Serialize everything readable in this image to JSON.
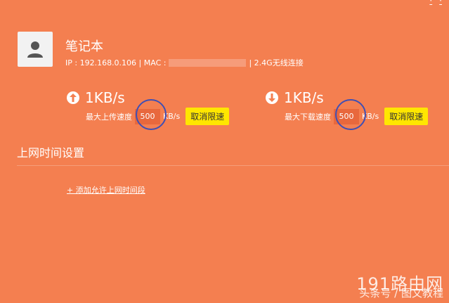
{
  "top_links": [
    "·",
    "·"
  ],
  "device": {
    "name": "笔记本",
    "ip_text": "IP : 192.168.0.106 | MAC :",
    "connection_text": "| 2.4G无线连接"
  },
  "upload": {
    "speed": "1KB/s",
    "label": "最大上传速度",
    "limit_value": "500",
    "unit": "KB/s",
    "cancel_label": "取消限速"
  },
  "download": {
    "speed": "1KB/s",
    "label": "最大下载速度",
    "limit_value": "500",
    "unit": "KB/s",
    "cancel_label": "取消限速"
  },
  "schedule": {
    "title": "上网时间设置",
    "add_label": "+ 添加允许上网时间段"
  },
  "watermark": {
    "main": "191路由网",
    "sub": "头条号 / 图文教程"
  },
  "colors": {
    "background": "#f47f50",
    "button": "#ffe600",
    "annotation": "#3f4fb4"
  },
  "icons": {
    "avatar": "user-icon",
    "upload": "arrow-up-icon",
    "download": "arrow-down-icon"
  }
}
